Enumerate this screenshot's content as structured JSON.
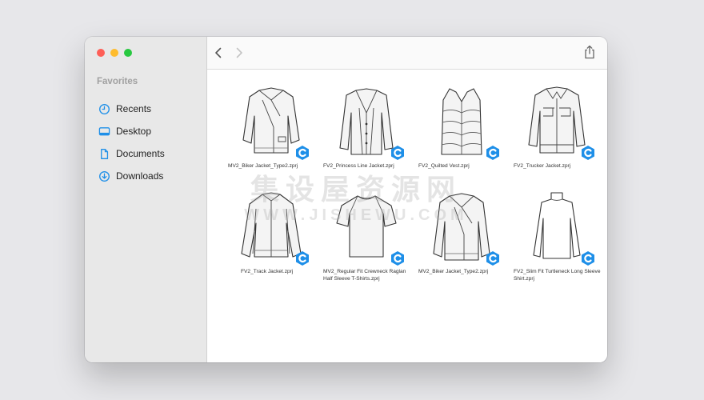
{
  "sidebar": {
    "section_title": "Favorites",
    "items": [
      {
        "label": "Recents",
        "icon": "clock-icon"
      },
      {
        "label": "Desktop",
        "icon": "desktop-icon"
      },
      {
        "label": "Documents",
        "icon": "document-icon"
      },
      {
        "label": "Downloads",
        "icon": "download-icon"
      }
    ]
  },
  "colors": {
    "accent": "#1e8fe8",
    "sidebar_bg": "#e8e8e8"
  },
  "files": [
    {
      "name": "MV2_Biker Jacket_Type2.zprj"
    },
    {
      "name": "FV2_Princess Line Jacket.zprj"
    },
    {
      "name": "FV2_Quilted Vest.zprj"
    },
    {
      "name": "FV2_Trucker Jacket.zprj"
    },
    {
      "name": "FV2_Track Jacket.zprj"
    },
    {
      "name": "MV2_Regular Fit Crewneck Raglan Half Sleeve T-Shirts.zprj"
    },
    {
      "name": "MV2_Biker Jacket_Type2.zprj"
    },
    {
      "name": "FV2_Slim Fit Turtleneck Long Sleeve Shirt.zprj"
    }
  ],
  "watermark": {
    "cn": "集设屋资源网",
    "en": "WWW.JISHEWU.COM"
  }
}
